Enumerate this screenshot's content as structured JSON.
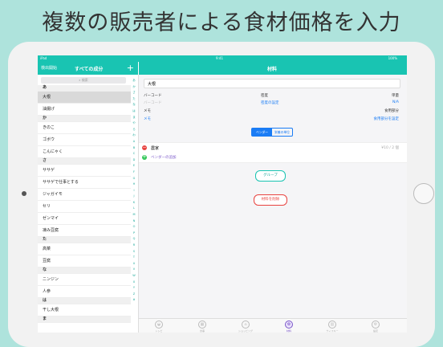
{
  "headline": "複数の販売者による食材価格を入力",
  "status": {
    "carrier": "iPad",
    "time": "9:41",
    "battery": "100%"
  },
  "left_nav": {
    "edit": "検出開始",
    "title": "すべての成分",
    "add": "+"
  },
  "search": {
    "placeholder": "検索"
  },
  "index": [
    "あ",
    "か",
    "さ",
    "た",
    "な",
    "は",
    "ま",
    "や",
    "ら",
    "わ",
    "A",
    "B",
    "C",
    "D",
    "E",
    "F",
    "G",
    "H",
    "I",
    "J",
    "K",
    "L",
    "M",
    "N",
    "O",
    "P",
    "Q",
    "R",
    "S",
    "T",
    "U",
    "V",
    "W",
    "X",
    "Y",
    "Z",
    "#"
  ],
  "list": [
    {
      "type": "sec",
      "label": "あ"
    },
    {
      "type": "item",
      "label": "大根",
      "selected": true
    },
    {
      "type": "item",
      "label": "油揚げ"
    },
    {
      "type": "sec",
      "label": "か"
    },
    {
      "type": "item",
      "label": "きのこ"
    },
    {
      "type": "item",
      "label": "ゴボウ"
    },
    {
      "type": "item",
      "label": "こんにゃく"
    },
    {
      "type": "sec",
      "label": "さ"
    },
    {
      "type": "item",
      "label": "ササゲ"
    },
    {
      "type": "item",
      "label": "ササゲで仕事とする"
    },
    {
      "type": "item",
      "label": "ジャガイモ"
    },
    {
      "type": "item",
      "label": "セリ"
    },
    {
      "type": "item",
      "label": "ゼンマイ"
    },
    {
      "type": "item",
      "label": "凍み豆腐"
    },
    {
      "type": "sec",
      "label": "た"
    },
    {
      "type": "item",
      "label": "高菜"
    },
    {
      "type": "item",
      "label": "豆腐"
    },
    {
      "type": "sec",
      "label": "な"
    },
    {
      "type": "item",
      "label": "ニンジン"
    },
    {
      "type": "item",
      "label": "人参"
    },
    {
      "type": "sec",
      "label": "は"
    },
    {
      "type": "item",
      "label": "干し大根"
    },
    {
      "type": "sec",
      "label": "ま"
    }
  ],
  "right_nav": {
    "title": "材料"
  },
  "detail": {
    "name": "大根",
    "barcode_label": "バーコード",
    "barcode_placeholder": "バーコード",
    "density_label": "密度",
    "density_link": "密度の設定",
    "unit_label": "単量",
    "unit_value": "N/A",
    "memo_label": "メモ",
    "memo_placeholder": "メモ",
    "usage_label": "食用部分",
    "usage_link": "食用部分を設定",
    "seg_vendor": "ベンダー",
    "seg_nutrition": "栄養の単位",
    "vendor_name": "農家",
    "vendor_price": "¥10 / 2 個",
    "add_vendor": "ベンダーの追加",
    "group_button": "グループ",
    "delete_button": "材料を削除"
  },
  "tabs": [
    {
      "label": "レシピ",
      "icon": "dish-icon"
    },
    {
      "label": "食事",
      "icon": "calendar-icon"
    },
    {
      "label": "ショッピング",
      "icon": "cart-icon"
    },
    {
      "label": "材料",
      "icon": "vegetable-icon",
      "active": true
    },
    {
      "label": "ウィスキー",
      "icon": "glass-icon"
    },
    {
      "label": "設定",
      "icon": "gear-icon"
    }
  ],
  "colors": {
    "accent": "#19c4b2",
    "link": "#1a7cf5",
    "delete": "#e8423f",
    "add": "#34c759",
    "active_tab": "#7a56c9"
  }
}
